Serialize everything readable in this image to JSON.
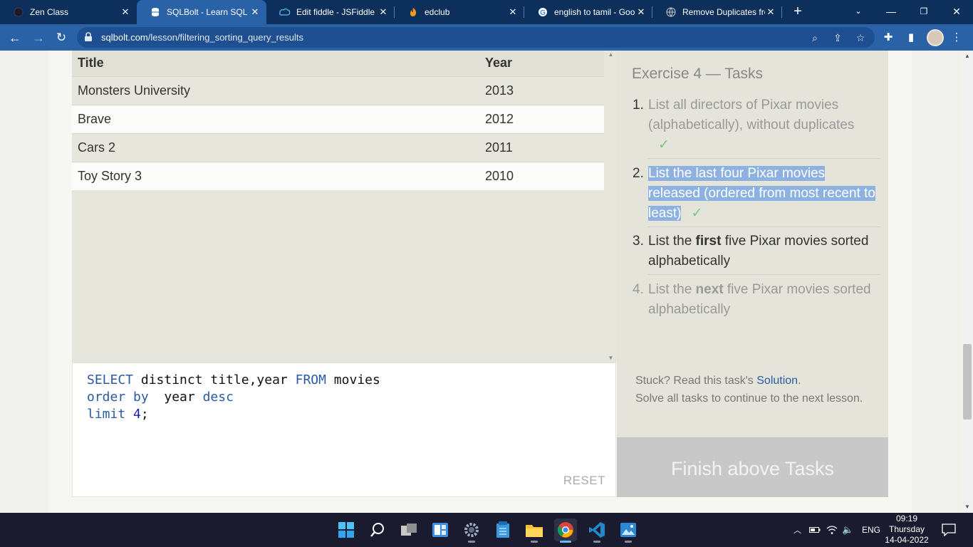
{
  "browser": {
    "tabs": [
      {
        "title": "Zen Class",
        "icon": "zen-class-icon",
        "active": false
      },
      {
        "title": "SQLBolt - Learn SQL -",
        "icon": "database-icon",
        "active": true
      },
      {
        "title": "Edit fiddle - JSFiddle -",
        "icon": "jsfiddle-icon",
        "active": false
      },
      {
        "title": "edclub",
        "icon": "edclub-icon",
        "active": false
      },
      {
        "title": "english to tamil - Goo",
        "icon": "google-icon",
        "active": false
      },
      {
        "title": "Remove Duplicates fro",
        "icon": "globe-icon",
        "active": false
      }
    ],
    "url_domain": "sqlbolt.com",
    "url_path": "/lesson/filtering_sorting_query_results"
  },
  "results": {
    "headers": [
      "Title",
      "Year"
    ],
    "rows": [
      [
        "Monsters University",
        "2013"
      ],
      [
        "Brave",
        "2012"
      ],
      [
        "Cars 2",
        "2011"
      ],
      [
        "Toy Story 3",
        "2010"
      ]
    ]
  },
  "editor": {
    "line1": {
      "kw1": "SELECT",
      "mid": " distinct title,year ",
      "kw2": "FROM",
      "end": " movies"
    },
    "line2": {
      "kw1": "order by",
      "mid": "  year ",
      "kw2": "desc"
    },
    "line3": {
      "kw1": "limit",
      "sp": " ",
      "num": "4",
      "end": ";"
    },
    "reset_label": "RESET"
  },
  "tasks": {
    "title": "Exercise 4 — Tasks",
    "items": [
      {
        "num": "1.",
        "text": "List all directors of Pixar movies (alphabetically), without duplicates",
        "check": "✓"
      },
      {
        "num": "2.",
        "text": "List the last four Pixar movies released (ordered from most recent to least)",
        "check": "✓"
      },
      {
        "num": "3.",
        "pre": "List the ",
        "bold": "first",
        "post": " five Pixar movies sorted alphabetically"
      },
      {
        "num": "4.",
        "pre": "List the ",
        "bold": "next",
        "post": " five Pixar movies sorted alphabetically"
      }
    ],
    "stuck_pre": "Stuck? Read this task's ",
    "stuck_link": "Solution",
    "stuck_post": ".",
    "solve_all": "Solve all tasks to continue to the next lesson.",
    "finish_label": "Finish above Tasks"
  },
  "taskbar": {
    "lang": "ENG",
    "time": "09:19",
    "day": "Thursday",
    "date": "14-04-2022"
  },
  "colors": {
    "chrome_dark": "#0d2f5c",
    "chrome_light": "#2a62a8",
    "sql_keyword": "#2c5aa0",
    "check": "#7bc67b",
    "selection": "#8db2e2"
  }
}
